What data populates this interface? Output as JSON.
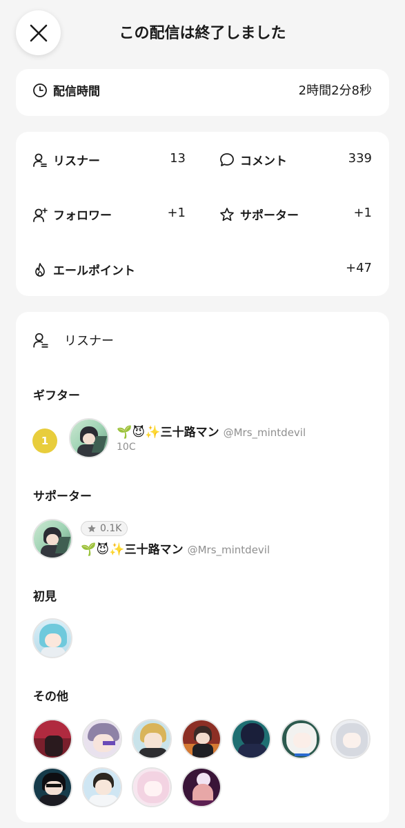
{
  "header": {
    "title": "この配信は終了しました",
    "close_icon": "close-icon"
  },
  "duration": {
    "label": "配信時間",
    "value": "2時間2分8秒",
    "icon": "clock-icon"
  },
  "stats": {
    "listeners": {
      "label": "リスナー",
      "value": "13",
      "icon": "person-list-icon"
    },
    "comments": {
      "label": "コメント",
      "value": "339",
      "icon": "speech-bubble-icon"
    },
    "followers": {
      "label": "フォロワー",
      "value": "+1",
      "icon": "person-plus-icon"
    },
    "supporters": {
      "label": "サポーター",
      "value": "+1",
      "icon": "star-icon"
    },
    "yell_points": {
      "label": "エールポイント",
      "value": "+47",
      "icon": "flame-icon"
    }
  },
  "listeners_section": {
    "title": "リスナー",
    "icon": "person-list-icon",
    "gifters": {
      "label": "ギフター",
      "items": [
        {
          "rank": "1",
          "emoji": "🌱😈✨",
          "name": "三十路マン",
          "handle": "@Mrs_mintdevil",
          "amount": "10C"
        }
      ]
    },
    "supporters": {
      "label": "サポーター",
      "items": [
        {
          "badge": "0.1K",
          "emoji": "🌱😈✨",
          "name": "三十路マン",
          "handle": "@Mrs_mintdevil"
        }
      ]
    },
    "first_time": {
      "label": "初見"
    },
    "others": {
      "label": "その他"
    }
  },
  "colors": {
    "background": "#f5f5f5",
    "card": "#ffffff",
    "rank_badge": "#e8cd3c",
    "muted_text": "#8f8f8f"
  }
}
